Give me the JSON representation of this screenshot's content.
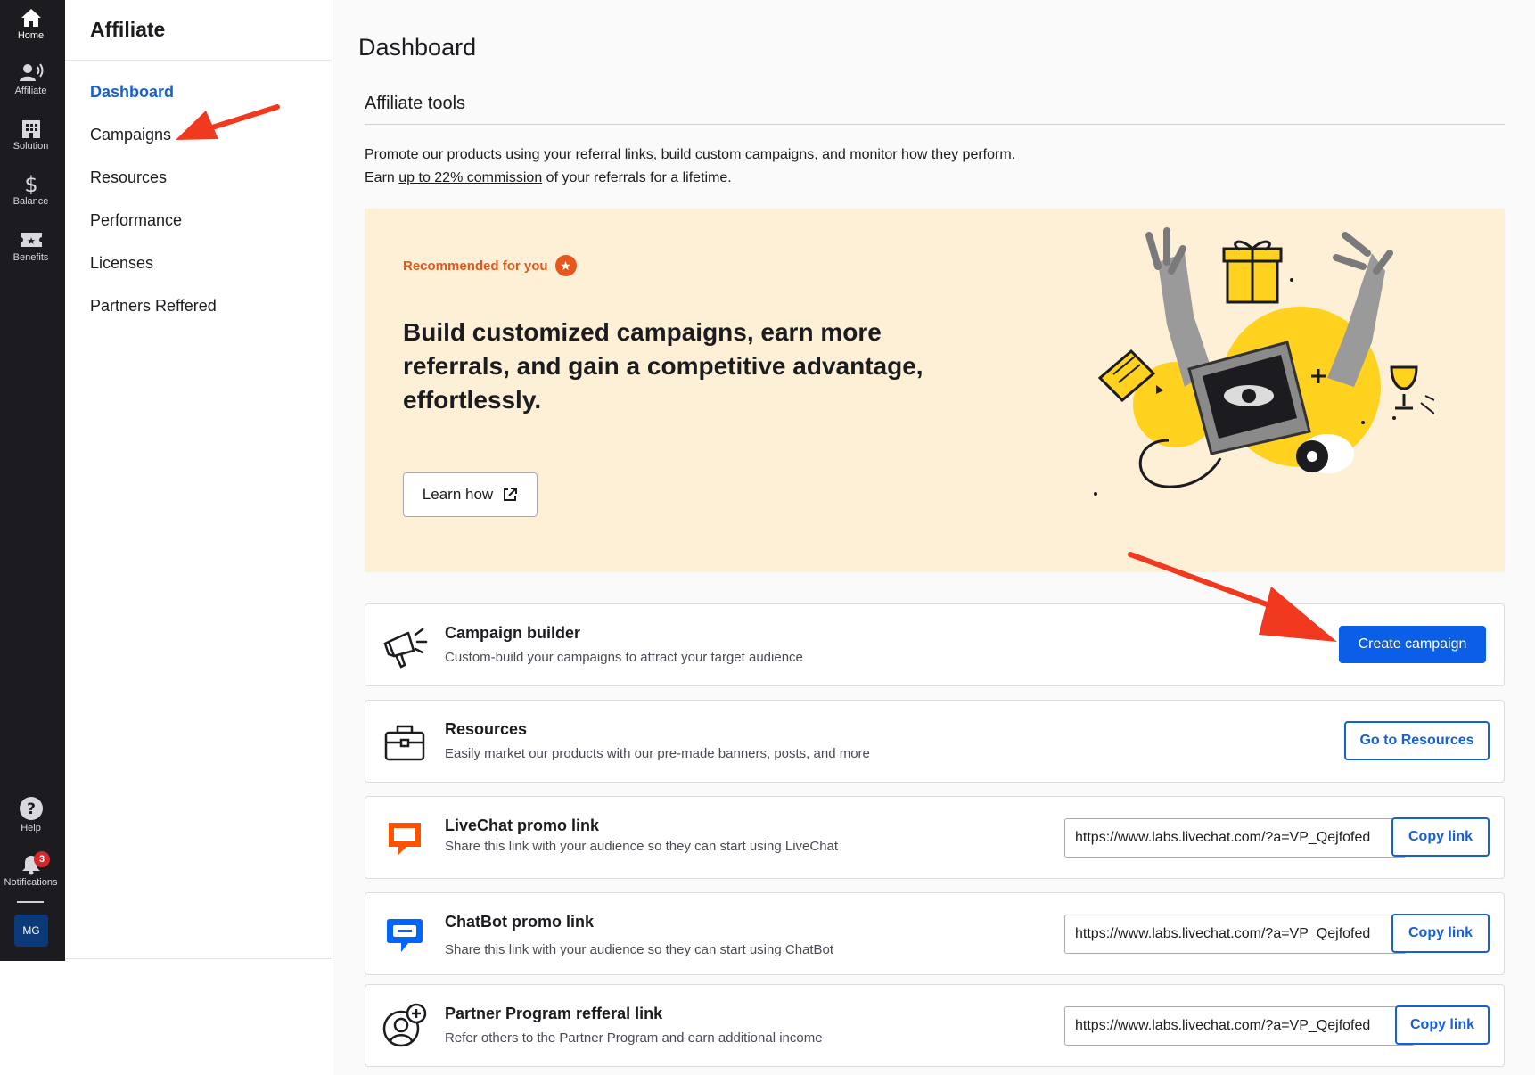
{
  "rail": {
    "items": [
      {
        "label": "Home",
        "icon": "home-icon"
      },
      {
        "label": "Affiliate",
        "icon": "affiliate-icon"
      },
      {
        "label": "Solution",
        "icon": "building-icon"
      },
      {
        "label": "Balance",
        "icon": "dollar-icon"
      },
      {
        "label": "Benefits",
        "icon": "ticket-icon"
      }
    ],
    "bottom": [
      {
        "label": "Help",
        "icon": "help-icon"
      },
      {
        "label": "Notifications",
        "icon": "bell-icon",
        "badge": "3"
      }
    ],
    "avatar": "MG"
  },
  "subnav": {
    "title": "Affiliate",
    "items": [
      "Dashboard",
      "Campaigns",
      "Resources",
      "Performance",
      "Licenses",
      "Partners Reffered"
    ],
    "active": "Dashboard"
  },
  "main": {
    "title": "Dashboard",
    "section_title": "Affiliate tools",
    "intro_line1": "Promote our products using your referral links, build custom campaigns, and monitor how they perform.",
    "intro_line2_prefix": "Earn ",
    "intro_line2_link": "up to 22% commission",
    "intro_line2_suffix": " of your referrals for a lifetime."
  },
  "promo": {
    "tag": "Recommended for you",
    "headline": "Build customized campaigns, earn more referrals, and gain a competitive advantage, effortlessly.",
    "button": "Learn how"
  },
  "cards": {
    "campaign": {
      "title": "Campaign builder",
      "subtitle": "Custom-build your campaigns to attract your target audience",
      "button": "Create campaign"
    },
    "resources": {
      "title": "Resources",
      "subtitle": "Easily market our products with our pre-made banners, posts, and more",
      "button": "Go to Resources"
    },
    "livechat": {
      "title": "LiveChat promo link",
      "subtitle": "Share this link with your audience so they can start using LiveChat",
      "link": "https://www.labs.livechat.com/?a=VP_Qejfofed",
      "button": "Copy link"
    },
    "chatbot": {
      "title": "ChatBot promo link",
      "subtitle": "Share this link with your audience so they can start using ChatBot",
      "link": "https://www.labs.livechat.com/?a=VP_Qejfofed",
      "button": "Copy link"
    },
    "partner": {
      "title": "Partner Program refferal link",
      "subtitle": "Refer others to the Partner Program and earn additional income",
      "link": "https://www.labs.livechat.com/?a=VP_Qejfofed",
      "button": "Copy link"
    }
  },
  "colors": {
    "rail_bg": "#1b1b20",
    "accent": "#0a5ee8",
    "active_nav": "#1760d4",
    "promo_bg": "#fef0d6",
    "promo_tag": "#e7561b",
    "annotation_arrow": "#f0391e",
    "livechat_orange": "#ff5100",
    "chatbot_blue": "#0066ff"
  }
}
